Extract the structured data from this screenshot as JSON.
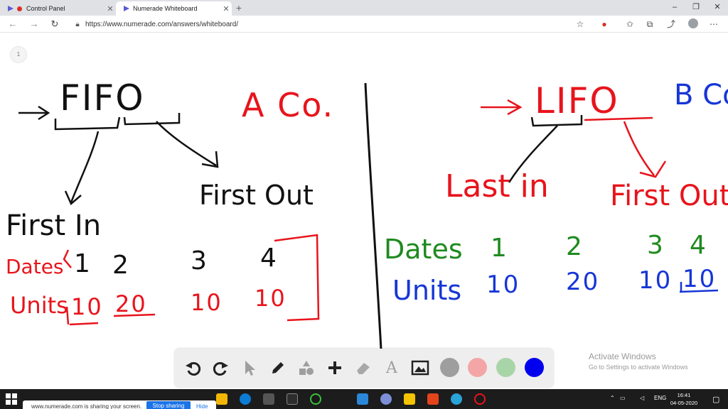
{
  "browser": {
    "tabs": [
      {
        "label": "Control Panel",
        "active": false
      },
      {
        "label": "Numerade Whiteboard",
        "active": true
      }
    ],
    "new_tab_label": "+",
    "window_controls": [
      "–",
      "❐",
      "✕"
    ],
    "url": "https://www.numerade.com/answers/whiteboard/",
    "page_indicator": "1"
  },
  "whiteboard": {
    "left": {
      "title": "FIFO",
      "company": "A Co.",
      "first_in": "First In",
      "first_out": "First Out",
      "dates_label": "Dates",
      "units_label": "Units",
      "dates": [
        "1",
        "2",
        "3",
        "4"
      ],
      "units": [
        "10",
        "20",
        "10",
        "10"
      ],
      "ink": "#e8141c"
    },
    "right": {
      "title": "LIFO",
      "company": "B Co.",
      "last_in": "Last in",
      "first_out": "First Out",
      "dates_label": "Dates",
      "units_label": "Units",
      "dates": [
        "1",
        "2",
        "3",
        "4"
      ],
      "units": [
        "10",
        "20",
        "10",
        "10"
      ],
      "dates_ink": "#1f8a1f",
      "units_ink": "#1636d6"
    }
  },
  "draw_toolbar": {
    "tools": [
      "undo-icon",
      "redo-icon",
      "pointer-icon",
      "pen-icon",
      "shapes-icon",
      "plus-icon",
      "eraser-icon",
      "text-icon",
      "image-icon"
    ],
    "colors": [
      "#9e9e9e",
      "#f4a6a6",
      "#a8d5a8",
      "#0000ee"
    ]
  },
  "watermark": {
    "title": "Activate Windows",
    "subtitle": "Go to Settings to activate Windows"
  },
  "share_bar": {
    "message": "www.numerade.com is sharing your screen.",
    "stop_label": "Stop sharing",
    "hide_label": "Hide"
  },
  "taskbar": {
    "language": "ENG",
    "time": "16:41",
    "date": "04-05-2020"
  }
}
